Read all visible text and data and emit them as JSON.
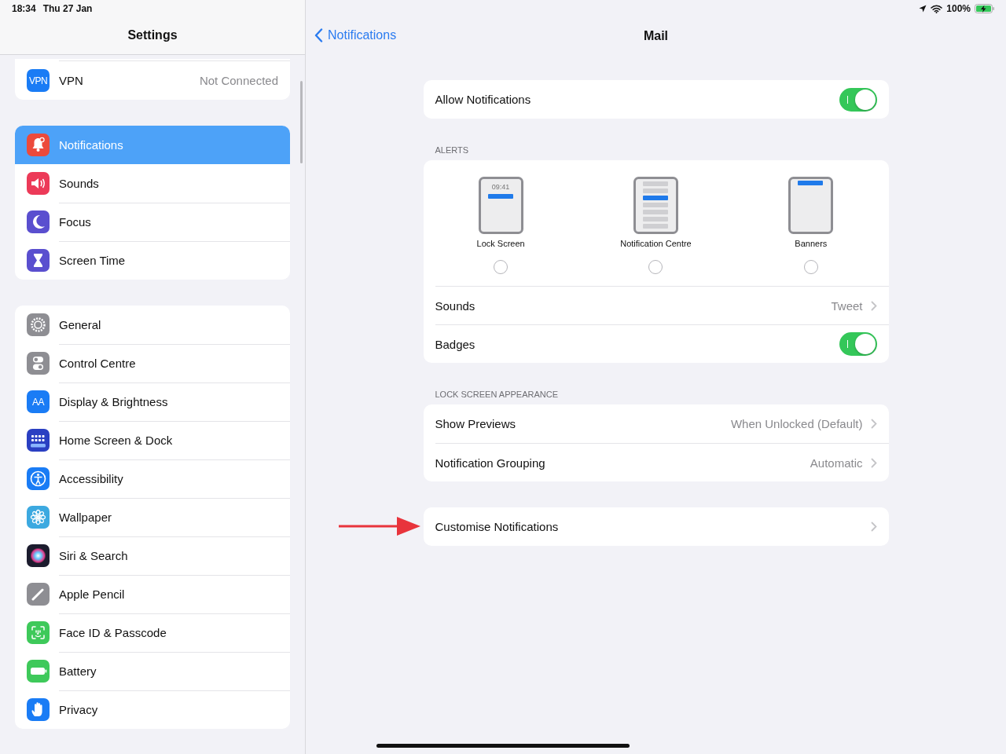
{
  "status_bar": {
    "time": "18:34",
    "date": "Thu 27 Jan",
    "battery": "100%",
    "charging": true
  },
  "sidebar": {
    "title": "Settings",
    "groups": [
      {
        "items": [
          {
            "label": "VPN",
            "icon_text": "VPN",
            "value": "Not Connected",
            "color": "#1a7cf5",
            "selected": false
          }
        ]
      },
      {
        "items": [
          {
            "label": "Notifications",
            "color": "#ec4a3c",
            "selected": true
          },
          {
            "label": "Sounds",
            "color": "#ec3a58",
            "selected": false
          },
          {
            "label": "Focus",
            "color": "#5a4fcf",
            "selected": false
          },
          {
            "label": "Screen Time",
            "color": "#5a4fcf",
            "selected": false
          }
        ]
      },
      {
        "items": [
          {
            "label": "General",
            "color": "#8e8e93",
            "selected": false
          },
          {
            "label": "Control Centre",
            "color": "#8e8e93",
            "selected": false
          },
          {
            "label": "Display & Brightness",
            "icon_text": "AA",
            "color": "#1a7cf5",
            "selected": false
          },
          {
            "label": "Home Screen & Dock",
            "color": "#2a3fc2",
            "selected": false
          },
          {
            "label": "Accessibility",
            "color": "#1a7cf5",
            "selected": false
          },
          {
            "label": "Wallpaper",
            "color": "#3ca9e0",
            "selected": false
          },
          {
            "label": "Siri & Search",
            "color": "#1c1c2e",
            "selected": false
          },
          {
            "label": "Apple Pencil",
            "color": "#8e8e93",
            "selected": false
          },
          {
            "label": "Face ID & Passcode",
            "color": "#3ec95a",
            "selected": false
          },
          {
            "label": "Battery",
            "color": "#3ec95a",
            "selected": false
          },
          {
            "label": "Privacy",
            "color": "#1a7cf5",
            "selected": false
          }
        ]
      }
    ]
  },
  "detail": {
    "back": "Notifications",
    "title": "Mail",
    "sections": [
      {
        "rows": [
          {
            "kind": "toggle",
            "label": "Allow Notifications",
            "on": true
          }
        ]
      },
      {
        "header": "ALERTS",
        "alert_styles": [
          {
            "kind": "lock",
            "label": "Lock Screen",
            "time": "09:41",
            "selected": false
          },
          {
            "kind": "centre",
            "label": "Notification Centre",
            "selected": false
          },
          {
            "kind": "banner",
            "label": "Banners",
            "selected": false
          }
        ],
        "rows": [
          {
            "kind": "link",
            "label": "Sounds",
            "value": "Tweet"
          },
          {
            "kind": "toggle",
            "label": "Badges",
            "on": true
          }
        ]
      },
      {
        "header": "LOCK SCREEN APPEARANCE",
        "rows": [
          {
            "kind": "link",
            "label": "Show Previews",
            "value": "When Unlocked (Default)"
          },
          {
            "kind": "link",
            "label": "Notification Grouping",
            "value": "Automatic"
          }
        ]
      },
      {
        "pointer_arrow": true,
        "rows": [
          {
            "kind": "link",
            "label": "Customise Notifications"
          }
        ]
      }
    ]
  }
}
